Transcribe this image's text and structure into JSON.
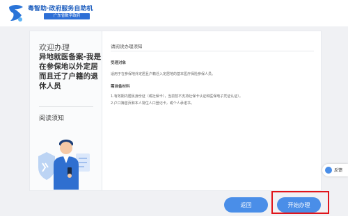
{
  "header": {
    "logo_title": "粤智助·政府服务自助机",
    "logo_subtitle": "广东省数字政府"
  },
  "left_pane": {
    "welcome": "欢迎办理",
    "headline": "异地就医备案-我是在参保地以外定居而且迁了户籍的退休人员",
    "reading_tab": "阅读须知"
  },
  "notice": {
    "title": "请阅读办理须知",
    "section1_title": "受理对象",
    "section1_line1": "适用于在参保地外定居且户籍迁入定居地的基本医疗保险参保人员。",
    "section2_title": "需准备材料",
    "section2_line1": "1.有效期内居民身份证（或社保卡），当前暂不支持社保卡认证和医保电子凭证认证）。",
    "section2_line2": "2.户口簿首页和本人常住人口登记卡，或个人承诺书。"
  },
  "buttons": {
    "back": "返回",
    "start": "开始办理"
  },
  "feedback": {
    "label": "反馈"
  },
  "colors": {
    "accent": "#4a8ee8",
    "highlight": "#e0151b",
    "background": "#f0f1f4"
  }
}
